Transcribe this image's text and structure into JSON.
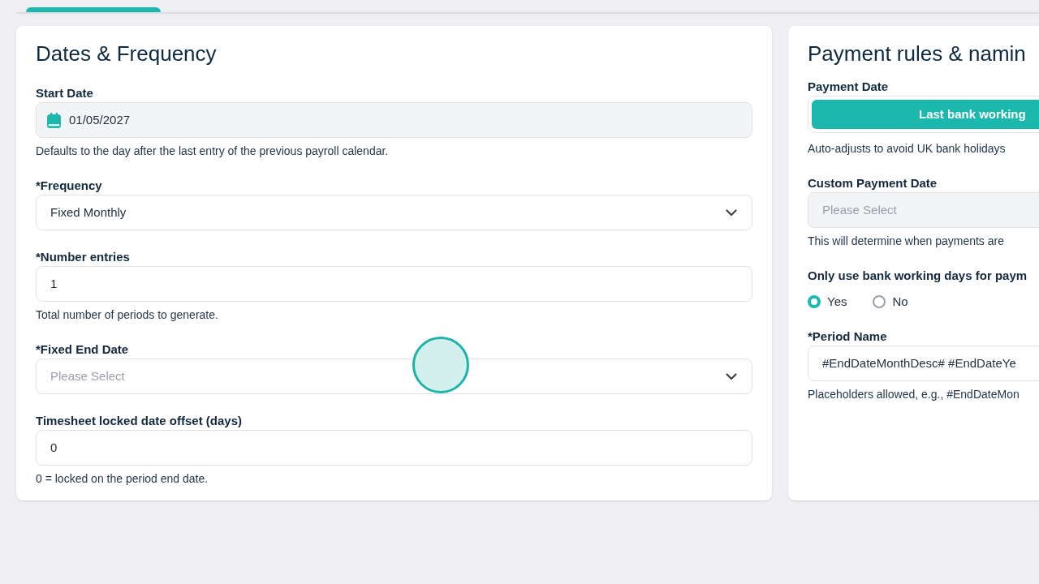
{
  "cards": [
    {
      "title": "Dates & Frequency",
      "fields": [
        {
          "kind": "date",
          "label": "Start Date",
          "value": "01/05/2027",
          "disabled": true,
          "help": "Defaults to the day after the last entry of the previous payroll calendar."
        },
        {
          "kind": "select",
          "label": "*Frequency",
          "value": "Fixed Monthly",
          "disabled": false
        },
        {
          "kind": "input",
          "label": "*Number entries",
          "value": "1",
          "disabled": false,
          "help": "Total number of periods to generate."
        },
        {
          "kind": "select",
          "label": "*Fixed End Date",
          "placeholder": "Please Select",
          "disabled": false
        },
        {
          "kind": "input",
          "label": "Timesheet locked date offset (days)",
          "value": "0",
          "disabled": false,
          "help": "0 = locked on the period end date."
        }
      ]
    },
    {
      "title": "Payment rules & namin",
      "fields": [
        {
          "kind": "segmented",
          "label": "Payment Date",
          "disabled": false,
          "options": [
            {
              "label": "Last bank working",
              "selected": true
            }
          ],
          "help": "Auto-adjusts to avoid UK bank holidays"
        },
        {
          "kind": "select",
          "label": "Custom Payment Date",
          "placeholder": "Please Select",
          "disabled": true,
          "help": "This will determine when payments are"
        },
        {
          "kind": "radio",
          "label": "Only use bank working days for paym",
          "disabled": false,
          "options": [
            {
              "label": "Yes",
              "selected": true
            },
            {
              "label": "No",
              "selected": false
            }
          ]
        },
        {
          "kind": "input",
          "label": "*Period Name",
          "value": "#EndDateMonthDesc# #EndDateYe",
          "disabled": false,
          "help": "Placeholders allowed, e.g., #EndDateMon"
        }
      ]
    }
  ]
}
